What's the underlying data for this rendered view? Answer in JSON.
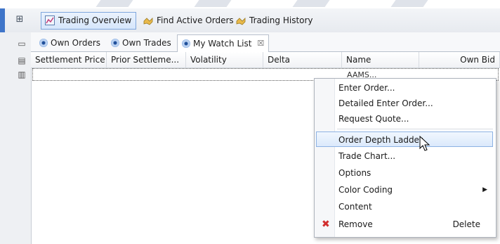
{
  "toolbar": {
    "items": [
      {
        "label": "Trading Overview",
        "icon": "chart-icon",
        "active": true
      },
      {
        "label": "Find Active Orders",
        "icon": "hands-icon",
        "active": false
      },
      {
        "label": "Trading History",
        "icon": "hands-icon",
        "active": false
      }
    ]
  },
  "tabs": [
    {
      "label": "Own Orders",
      "icon": "eye-icon"
    },
    {
      "label": "Own Trades",
      "icon": "eye-icon"
    },
    {
      "label": "My Watch List",
      "icon": "eye-icon",
      "active": true,
      "close": "☒"
    }
  ],
  "grid": {
    "columns": [
      "Settlement Price",
      "Prior Settleme...",
      "Volatility",
      "Delta",
      "Name",
      "Own Bid"
    ],
    "row_name": "AAMS..."
  },
  "context_menu": {
    "items": [
      {
        "label": "Enter Order..."
      },
      {
        "label": "Detailed Enter Order..."
      },
      {
        "label": "Request Quote..."
      },
      {
        "label": "Order Depth Ladder",
        "highlighted": true
      },
      {
        "label": "Trade Chart..."
      },
      {
        "label": "Options"
      },
      {
        "label": "Color Coding",
        "submenu": true
      },
      {
        "label": "Content"
      },
      {
        "label": "Remove",
        "shortcut": "Delete",
        "icon": "remove-x-icon"
      }
    ]
  },
  "colors": {
    "accent": "#3f75c9",
    "highlight_border": "#8db2e3",
    "remove_icon": "#d12d2d"
  }
}
